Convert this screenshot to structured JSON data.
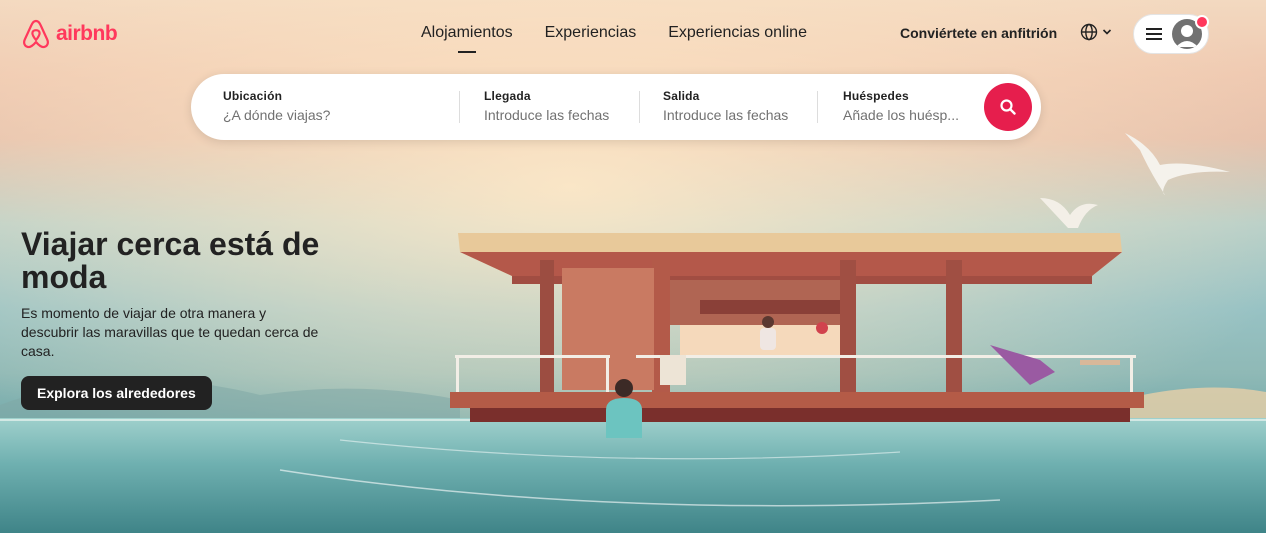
{
  "brand": {
    "name": "airbnb",
    "color": "#ff385c",
    "icon": "airbnb-logo-icon"
  },
  "nav": {
    "tabs": [
      {
        "label": "Alojamientos",
        "active": true
      },
      {
        "label": "Experiencias",
        "active": false
      },
      {
        "label": "Experiencias online",
        "active": false
      }
    ],
    "host_link": "Conviértete en anfitrión",
    "language_icon": "globe-icon",
    "menu_icon": "menu-icon",
    "avatar_icon": "user-avatar-icon"
  },
  "search": {
    "location": {
      "label": "Ubicación",
      "placeholder": "¿A dónde viajas?"
    },
    "checkin": {
      "label": "Llegada",
      "placeholder": "Introduce las fechas"
    },
    "checkout": {
      "label": "Salida",
      "placeholder": "Introduce las fechas"
    },
    "guests": {
      "label": "Huéspedes",
      "placeholder": "Añade los huésp..."
    },
    "button_icon": "search-icon",
    "button_color": "#e61e4d"
  },
  "hero": {
    "title": "Viajar cerca está de moda",
    "subtitle": "Es momento de viajar de otra manera y descubrir las maravillas que te quedan cerca de casa.",
    "cta": "Explora los alrededores",
    "image": "houseboat-illustration"
  }
}
